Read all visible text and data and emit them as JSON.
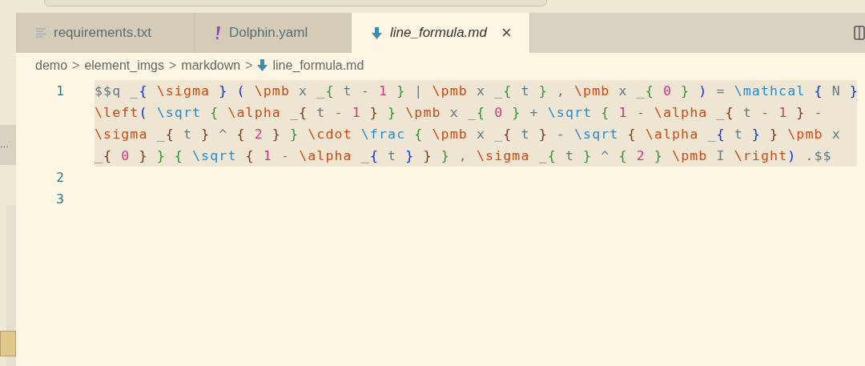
{
  "sidebar": {
    "item": "…"
  },
  "tabs": [
    {
      "label": "requirements.txt",
      "selected": false
    },
    {
      "label": "Dolphin.yaml",
      "selected": false
    },
    {
      "label": "line_formula.md",
      "selected": true,
      "close": "×"
    }
  ],
  "breadcrumb": {
    "parts": [
      "demo",
      "element_imgs",
      "markdown"
    ],
    "file": "line_formula.md",
    "separator": ">"
  },
  "editor": {
    "lines": [
      {
        "number": "1",
        "highlighted": true,
        "rows": [
          {
            "tokens": [
              {
                "text": "$$q _",
                "kind": "plain"
              },
              {
                "text": "{ ",
                "kind": "brace1"
              },
              {
                "text": "\\sigma ",
                "kind": "command"
              },
              {
                "text": "} ",
                "kind": "brace1"
              },
              {
                "text": "( ",
                "kind": "brace1"
              },
              {
                "text": "\\pmb ",
                "kind": "command"
              },
              {
                "text": "x _",
                "kind": "plain"
              },
              {
                "text": "{ ",
                "kind": "brace2"
              },
              {
                "text": "t - ",
                "kind": "plain"
              },
              {
                "text": "1 ",
                "kind": "number"
              },
              {
                "text": "} ",
                "kind": "brace2"
              },
              {
                "text": "| ",
                "kind": "plain"
              },
              {
                "text": "\\pmb ",
                "kind": "command"
              },
              {
                "text": "x _",
                "kind": "plain"
              },
              {
                "text": "{ ",
                "kind": "brace2"
              },
              {
                "text": "t ",
                "kind": "plain"
              },
              {
                "text": "} ",
                "kind": "brace2"
              },
              {
                "text": ", ",
                "kind": "plain"
              },
              {
                "text": "\\pmb ",
                "kind": "command"
              },
              {
                "text": "x _",
                "kind": "plain"
              },
              {
                "text": "{ ",
                "kind": "brace2"
              },
              {
                "text": "0 ",
                "kind": "number"
              },
              {
                "text": "} ",
                "kind": "brace2"
              },
              {
                "text": ") ",
                "kind": "brace1"
              },
              {
                "text": "= ",
                "kind": "plain"
              },
              {
                "text": "\\mathcal ",
                "kind": "function"
              },
              {
                "text": "{ ",
                "kind": "brace1"
              },
              {
                "text": "N ",
                "kind": "plain"
              },
              {
                "text": "}",
                "kind": "brace1"
              }
            ]
          },
          {
            "tokens": [
              {
                "text": "\\left",
                "kind": "command"
              },
              {
                "text": "( ",
                "kind": "brace1"
              },
              {
                "text": "\\sqrt ",
                "kind": "function"
              },
              {
                "text": "{ ",
                "kind": "brace2"
              },
              {
                "text": "\\alpha ",
                "kind": "command"
              },
              {
                "text": "_",
                "kind": "plain"
              },
              {
                "text": "{ ",
                "kind": "brace3"
              },
              {
                "text": "t - ",
                "kind": "plain"
              },
              {
                "text": "1 ",
                "kind": "number"
              },
              {
                "text": "} ",
                "kind": "brace3"
              },
              {
                "text": "} ",
                "kind": "brace2"
              },
              {
                "text": "\\pmb ",
                "kind": "command"
              },
              {
                "text": "x _",
                "kind": "plain"
              },
              {
                "text": "{ ",
                "kind": "brace2"
              },
              {
                "text": "0 ",
                "kind": "number"
              },
              {
                "text": "} ",
                "kind": "brace2"
              },
              {
                "text": "+ ",
                "kind": "plain"
              },
              {
                "text": "\\sqrt ",
                "kind": "function"
              },
              {
                "text": "{ ",
                "kind": "brace2"
              },
              {
                "text": "1 ",
                "kind": "number"
              },
              {
                "text": "- ",
                "kind": "plain"
              },
              {
                "text": "\\alpha ",
                "kind": "command"
              },
              {
                "text": "_",
                "kind": "plain"
              },
              {
                "text": "{ ",
                "kind": "brace3"
              },
              {
                "text": "t - ",
                "kind": "plain"
              },
              {
                "text": "1 ",
                "kind": "number"
              },
              {
                "text": "} ",
                "kind": "brace3"
              },
              {
                "text": "-",
                "kind": "plain"
              }
            ]
          },
          {
            "tokens": [
              {
                "text": "\\sigma ",
                "kind": "command"
              },
              {
                "text": "_",
                "kind": "plain"
              },
              {
                "text": "{ ",
                "kind": "brace3"
              },
              {
                "text": "t ",
                "kind": "plain"
              },
              {
                "text": "} ",
                "kind": "brace3"
              },
              {
                "text": "^ ",
                "kind": "plain"
              },
              {
                "text": "{ ",
                "kind": "brace3"
              },
              {
                "text": "2 ",
                "kind": "number"
              },
              {
                "text": "} ",
                "kind": "brace3"
              },
              {
                "text": "} ",
                "kind": "brace2"
              },
              {
                "text": "\\cdot ",
                "kind": "command"
              },
              {
                "text": "\\frac ",
                "kind": "function"
              },
              {
                "text": "{ ",
                "kind": "brace2"
              },
              {
                "text": "\\pmb ",
                "kind": "command"
              },
              {
                "text": "x _",
                "kind": "plain"
              },
              {
                "text": "{ ",
                "kind": "brace3"
              },
              {
                "text": "t ",
                "kind": "plain"
              },
              {
                "text": "} ",
                "kind": "brace3"
              },
              {
                "text": "- ",
                "kind": "plain"
              },
              {
                "text": "\\sqrt ",
                "kind": "function"
              },
              {
                "text": "{ ",
                "kind": "brace3"
              },
              {
                "text": "\\alpha ",
                "kind": "command"
              },
              {
                "text": "_",
                "kind": "plain"
              },
              {
                "text": "{ ",
                "kind": "brace1"
              },
              {
                "text": "t ",
                "kind": "plain"
              },
              {
                "text": "} ",
                "kind": "brace1"
              },
              {
                "text": "} ",
                "kind": "brace3"
              },
              {
                "text": "\\pmb ",
                "kind": "command"
              },
              {
                "text": "x",
                "kind": "plain"
              }
            ]
          },
          {
            "tokens": [
              {
                "text": "_",
                "kind": "plain"
              },
              {
                "text": "{ ",
                "kind": "brace3"
              },
              {
                "text": "0 ",
                "kind": "number"
              },
              {
                "text": "} ",
                "kind": "brace3"
              },
              {
                "text": "} ",
                "kind": "brace2"
              },
              {
                "text": "{ ",
                "kind": "brace2"
              },
              {
                "text": "\\sqrt ",
                "kind": "function"
              },
              {
                "text": "{ ",
                "kind": "brace3"
              },
              {
                "text": "1 ",
                "kind": "number"
              },
              {
                "text": "- ",
                "kind": "plain"
              },
              {
                "text": "\\alpha ",
                "kind": "command"
              },
              {
                "text": "_",
                "kind": "plain"
              },
              {
                "text": "{ ",
                "kind": "brace1"
              },
              {
                "text": "t ",
                "kind": "plain"
              },
              {
                "text": "} ",
                "kind": "brace1"
              },
              {
                "text": "} ",
                "kind": "brace3"
              },
              {
                "text": "} ",
                "kind": "brace2"
              },
              {
                "text": ", ",
                "kind": "plain"
              },
              {
                "text": "\\sigma ",
                "kind": "command"
              },
              {
                "text": "_",
                "kind": "plain"
              },
              {
                "text": "{ ",
                "kind": "brace2"
              },
              {
                "text": "t ",
                "kind": "plain"
              },
              {
                "text": "} ",
                "kind": "brace2"
              },
              {
                "text": "^ ",
                "kind": "plain"
              },
              {
                "text": "{ ",
                "kind": "brace2"
              },
              {
                "text": "2 ",
                "kind": "number"
              },
              {
                "text": "} ",
                "kind": "brace2"
              },
              {
                "text": "\\pmb ",
                "kind": "command"
              },
              {
                "text": "I ",
                "kind": "plain"
              },
              {
                "text": "\\right",
                "kind": "command"
              },
              {
                "text": ") ",
                "kind": "brace1"
              },
              {
                "text": ".$$",
                "kind": "plain"
              }
            ]
          }
        ]
      },
      {
        "number": "2",
        "highlighted": false
      },
      {
        "number": "3",
        "highlighted": false
      }
    ]
  }
}
